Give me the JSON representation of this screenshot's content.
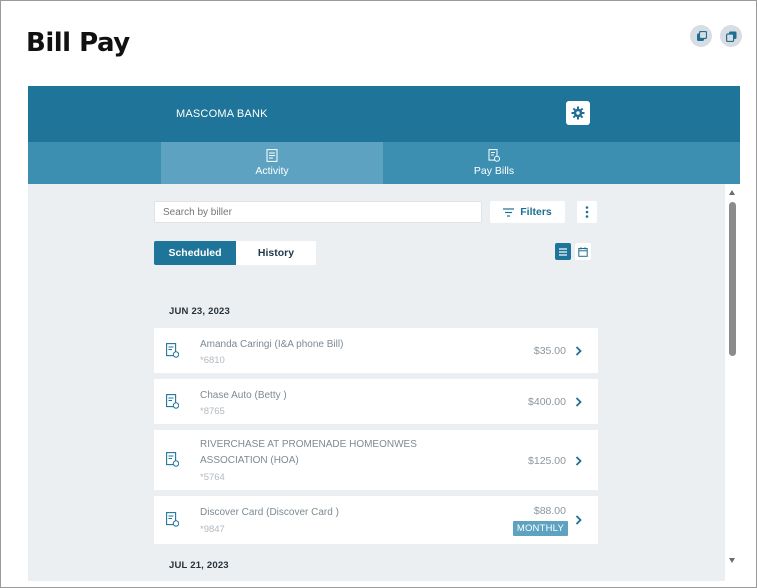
{
  "page": {
    "title": "Bill Pay"
  },
  "top_actions": [
    {
      "icon": "external-window-icon"
    },
    {
      "icon": "copy-window-icon"
    }
  ],
  "bank": {
    "name": "MASCOMA BANK",
    "settings_icon": "gear-icon"
  },
  "tabs": [
    {
      "label": "Activity",
      "icon": "activity-document-icon",
      "active": true
    },
    {
      "label": "Pay Bills",
      "icon": "pay-bills-icon",
      "active": false
    }
  ],
  "search": {
    "placeholder": "Search by biller",
    "value": ""
  },
  "filters": {
    "label": "Filters",
    "icon": "filter-lines-icon"
  },
  "more": {
    "icon": "vertical-dots-icon"
  },
  "segment": {
    "scheduled": "Scheduled",
    "history": "History",
    "selected": "Scheduled"
  },
  "view_toggle": {
    "list_icon": "list-view-icon",
    "calendar_icon": "calendar-view-icon",
    "selected": "list"
  },
  "groups": [
    {
      "date": "JUN 23, 2023",
      "payments": [
        {
          "name_lines": [
            "Amanda Caringi (I&A phone Bill)"
          ],
          "account": "*6810",
          "amount": "$35.00",
          "badge": ""
        },
        {
          "name_lines": [
            "Chase Auto (Betty )"
          ],
          "account": "*8765",
          "amount": "$400.00",
          "badge": ""
        },
        {
          "name_lines": [
            "RIVERCHASE AT PROMENADE HOMEONWES",
            "ASSOCIATION (HOA)"
          ],
          "account": "*5764",
          "amount": "$125.00",
          "badge": ""
        },
        {
          "name_lines": [
            "Discover Card (Discover Card )"
          ],
          "account": "*9847",
          "amount": "$88.00",
          "badge": "MONTHLY"
        }
      ]
    },
    {
      "date": "JUL 21, 2023",
      "payments": []
    }
  ],
  "colors": {
    "brand": "#1f7599",
    "tab_bar": "#3d8fb2",
    "tab_active": "#5da3c1",
    "background": "#eceff2"
  }
}
